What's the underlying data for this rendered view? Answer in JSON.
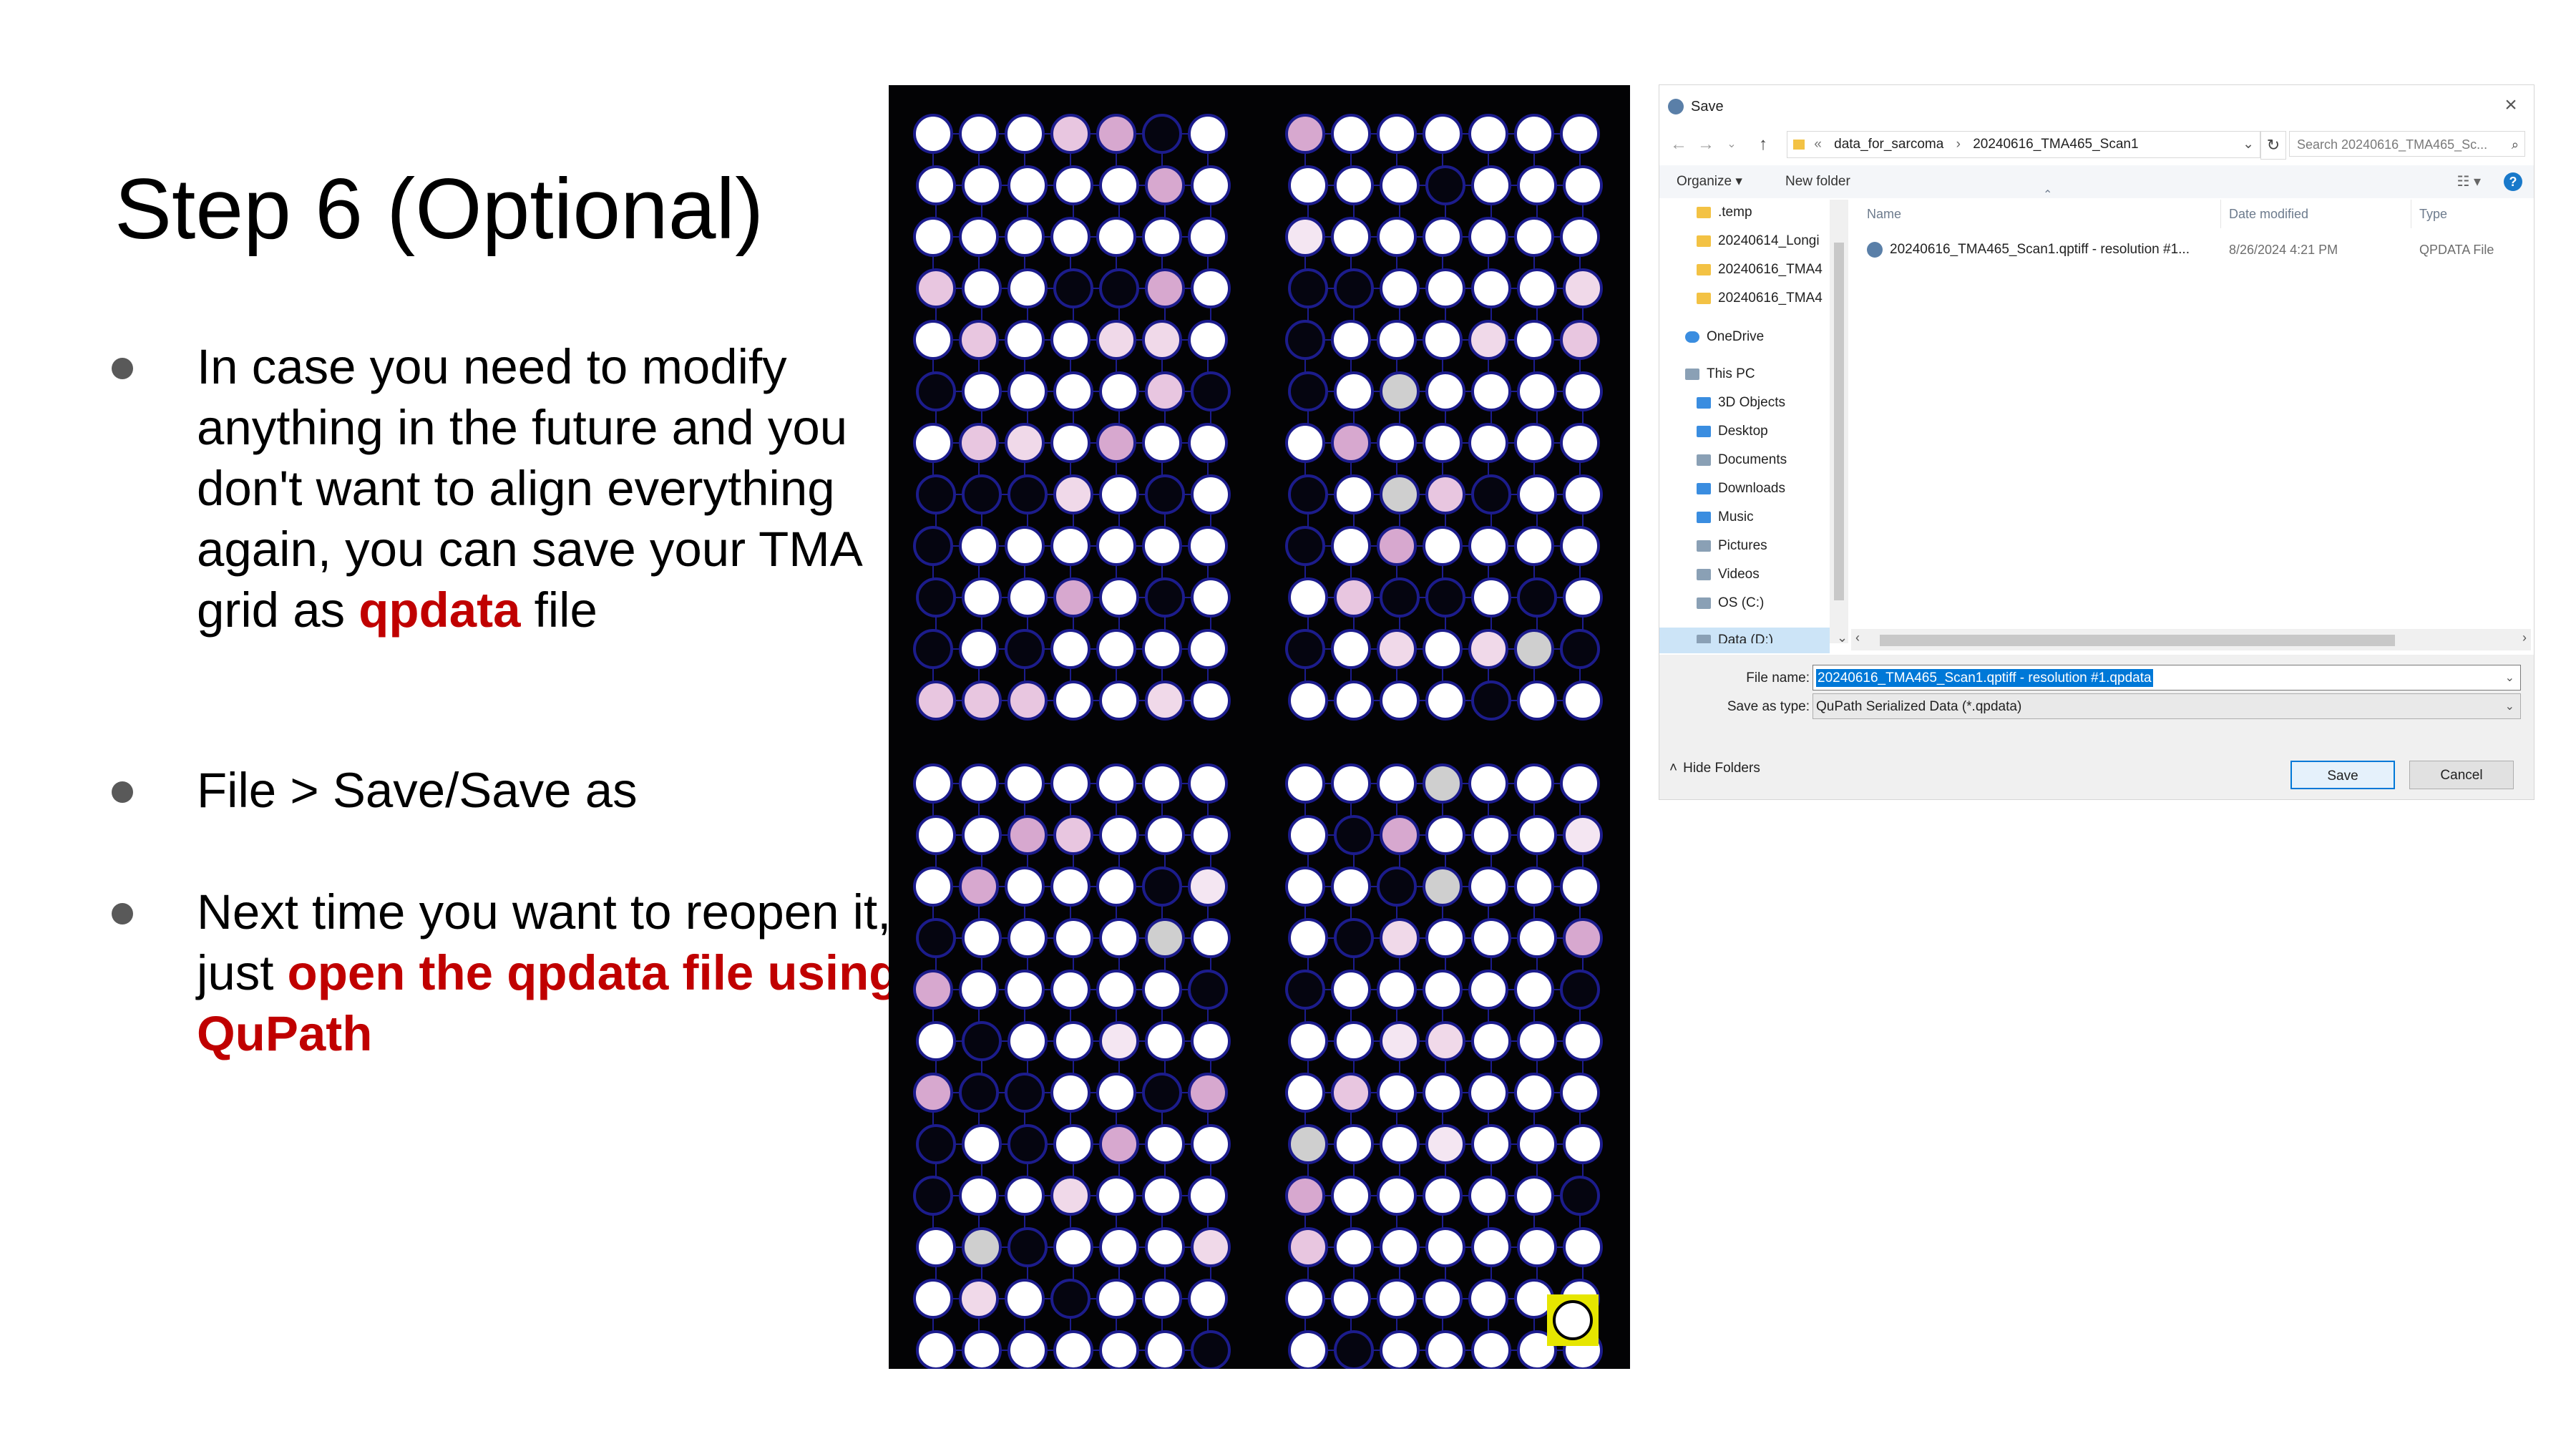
{
  "slide": {
    "title": "Step 6 (Optional)",
    "bullet1": {
      "pre": "In case you need to modify anything in the future and you don't want to align everything again, you can save your TMA grid as ",
      "highlight": "qpdata",
      "post": " file"
    },
    "bullet2": {
      "text": "File > Save/Save as"
    },
    "bullet3": {
      "pre": "Next time you want to reopen it, just ",
      "highlight": "open the qpdata file using QuPath"
    },
    "highlight_color": "#c00000"
  },
  "dialog": {
    "title": "Save",
    "address": {
      "prefix": "«",
      "parts": [
        "data_for_sarcoma",
        "20240616_TMA465_Scan1"
      ]
    },
    "search_placeholder": "Search 20240616_TMA465_Sc...",
    "toolbar": {
      "organize": "Organize ▾",
      "new_folder": "New folder"
    },
    "tree": [
      {
        "label": ".temp",
        "icon": "folder-icon"
      },
      {
        "label": "20240614_Longi",
        "icon": "folder-icon"
      },
      {
        "label": "20240616_TMA4",
        "icon": "folder-icon"
      },
      {
        "label": "20240616_TMA4",
        "icon": "folder-icon"
      },
      {
        "label": "OneDrive",
        "icon": "cloud-icon"
      },
      {
        "label": "This PC",
        "icon": "pc-icon"
      },
      {
        "label": "3D Objects",
        "icon": "cube-icon"
      },
      {
        "label": "Desktop",
        "icon": "desktop-icon"
      },
      {
        "label": "Documents",
        "icon": "document-icon"
      },
      {
        "label": "Downloads",
        "icon": "download-icon"
      },
      {
        "label": "Music",
        "icon": "music-icon"
      },
      {
        "label": "Pictures",
        "icon": "picture-icon"
      },
      {
        "label": "Videos",
        "icon": "video-icon"
      },
      {
        "label": "OS (C:)",
        "icon": "drive-icon"
      },
      {
        "label": "Data (D:)",
        "icon": "drive-icon"
      }
    ],
    "columns": {
      "name": "Name",
      "date": "Date modified",
      "type": "Type"
    },
    "files": [
      {
        "name": "20240616_TMA465_Scan1.qptiff - resolution #1...",
        "date": "8/26/2024 4:21 PM",
        "type": "QPDATA File"
      }
    ],
    "file_name_label": "File name:",
    "file_name_value": "20240616_TMA465_Scan1.qptiff - resolution #1.qpdata",
    "save_type_label": "Save as type:",
    "save_type_value": "QuPath Serialized Data (*.qpdata)",
    "hide_folders": "Hide Folders",
    "save_button": "Save",
    "cancel_button": "Cancel"
  },
  "tma": {
    "background": "#030305",
    "grid_color": "#1c1c8c",
    "core_color": "#ffffff"
  }
}
